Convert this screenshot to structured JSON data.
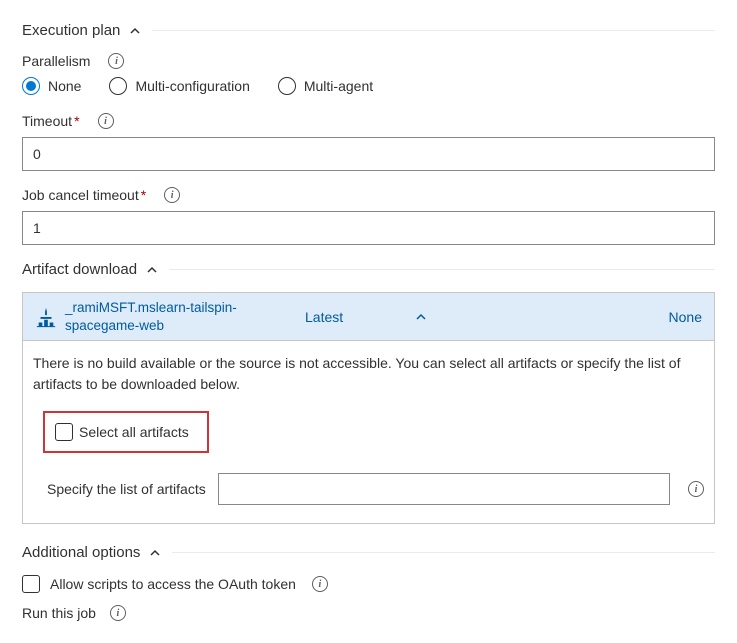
{
  "sections": {
    "execution_plan": {
      "title": "Execution plan"
    },
    "artifact_download": {
      "title": "Artifact download"
    },
    "additional_options": {
      "title": "Additional options"
    }
  },
  "parallelism": {
    "label": "Parallelism",
    "options": {
      "none": "None",
      "multi_config": "Multi-configuration",
      "multi_agent": "Multi-agent"
    },
    "selected": "none"
  },
  "timeout": {
    "label": "Timeout",
    "value": "0"
  },
  "job_cancel_timeout": {
    "label": "Job cancel timeout",
    "value": "1"
  },
  "artifact": {
    "name": "_ramiMSFT.mslearn-tailspin-spacegame-web",
    "version": "Latest",
    "selection": "None",
    "message": "There is no build available or the source is not accessible. You can select all artifacts or specify the list of artifacts to be downloaded below.",
    "select_all_label": "Select all artifacts",
    "specify_label": "Specify the list of artifacts",
    "specify_value": ""
  },
  "allow_scripts": {
    "label": "Allow scripts to access the OAuth token"
  },
  "run_job": {
    "label": "Run this job"
  }
}
